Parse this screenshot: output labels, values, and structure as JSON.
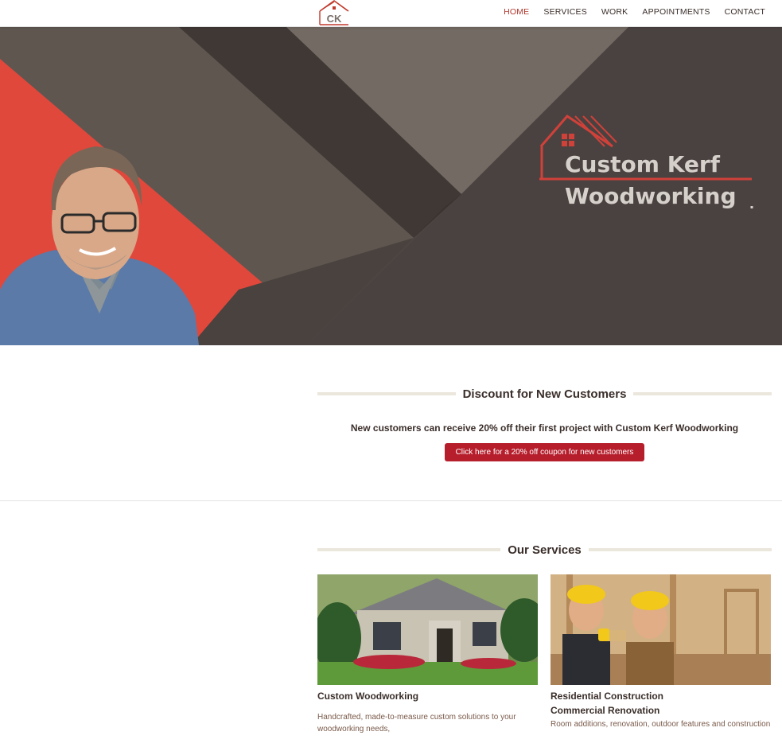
{
  "header": {
    "logo_text": "CK",
    "nav": [
      {
        "label": "HOME",
        "active": true
      },
      {
        "label": "SERVICES",
        "active": false
      },
      {
        "label": "WORK",
        "active": false
      },
      {
        "label": "APPOINTMENTS",
        "active": false
      },
      {
        "label": "CONTACT",
        "active": false
      }
    ]
  },
  "hero": {
    "brand_line1": "Custom Kerf",
    "brand_line2": "Woodworking"
  },
  "discount": {
    "title": "Discount for New Customers",
    "text": "New customers can receive 20% off their first project with Custom Kerf Woodworking",
    "button_label": "Click here for a 20% off coupon for new customers"
  },
  "services": {
    "title": "Our Services",
    "items": [
      {
        "title": "Custom Woodworking",
        "description": "Handcrafted, made-to-measure custom solutions to your woodworking needs,"
      },
      {
        "title_line1": "Residential Construction",
        "title_line2": "Commercial Renovation",
        "description": "Room additions, renovation, outdoor features and construction"
      }
    ]
  },
  "colors": {
    "accent_red": "#b61e2c",
    "nav_active": "#b0372d",
    "hero_dark": "#4a4240",
    "hero_mid": "#6b625c",
    "hero_red": "#e0483c",
    "text": "#3a2e2a",
    "rule": "#ece7dc"
  }
}
